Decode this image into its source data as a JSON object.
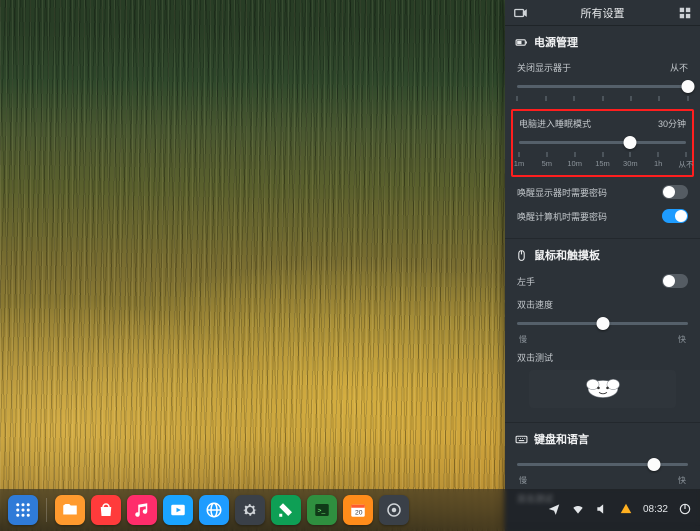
{
  "panel": {
    "title": "所有设置",
    "power": {
      "title": "电源管理",
      "display_off": {
        "label": "关闭显示器于",
        "value": "从不",
        "pos": 100,
        "ticks": [
          0,
          16.67,
          33.33,
          50,
          66.67,
          83.33,
          100
        ]
      },
      "sleep": {
        "label": "电脑进入睡眠模式",
        "value": "30分钟",
        "pos": 66.67,
        "ticks": [
          0,
          16.67,
          33.33,
          50,
          66.67,
          83.33,
          100
        ],
        "ticklabels": [
          "1m",
          "5m",
          "10m",
          "15m",
          "30m",
          "1h",
          "从不"
        ]
      },
      "wake_display_pw": {
        "label": "唤醒显示器时需要密码",
        "on": false
      },
      "wake_computer_pw": {
        "label": "唤醒计算机时需要密码",
        "on": true
      }
    },
    "mouse": {
      "title": "鼠标和触摸板",
      "left_hand": {
        "label": "左手",
        "on": false
      },
      "dbl_speed": {
        "label": "双击速度",
        "pos": 50,
        "low": "慢",
        "high": "快"
      },
      "dbl_test": {
        "label": "双击测试"
      }
    },
    "keyboard": {
      "title": "键盘和语言",
      "repeat": {
        "pos": 80,
        "low": "慢",
        "high": "快"
      },
      "test": {
        "label": "双击测试"
      }
    }
  },
  "dock": {
    "apps": [
      {
        "name": "launcher",
        "bg": "#2f7bd8"
      },
      {
        "name": "files",
        "bg": "#ff9a2e"
      },
      {
        "name": "store",
        "bg": "#ff3b3b"
      },
      {
        "name": "music",
        "bg": "#ff2d6b"
      },
      {
        "name": "video",
        "bg": "#1aa4ff"
      },
      {
        "name": "browser",
        "bg": "#1e9cff"
      },
      {
        "name": "settings",
        "bg": "#3a4048"
      },
      {
        "name": "editor",
        "bg": "#0e9f55"
      },
      {
        "name": "terminal",
        "bg": "#2f8f3f"
      },
      {
        "name": "calendar",
        "bg": "#ff8c1a"
      },
      {
        "name": "control",
        "bg": "#3a4048"
      }
    ],
    "time": "08:32"
  }
}
